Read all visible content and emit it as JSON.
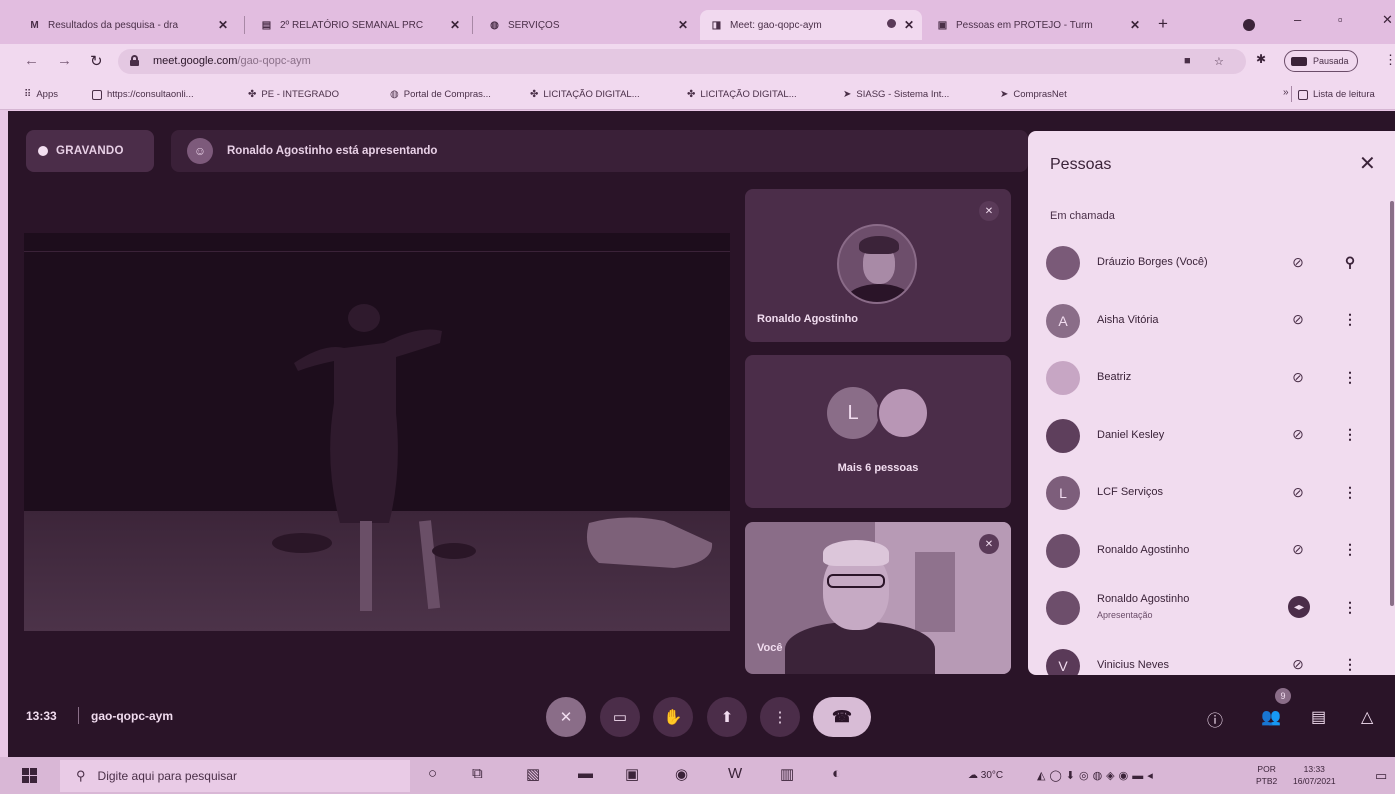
{
  "browser": {
    "tabs": [
      {
        "title": "Resultados da pesquisa - dra",
        "icon": "gmail-icon",
        "active": false
      },
      {
        "title": "2º RELATÓRIO SEMANAL PRC",
        "icon": "doc-icon",
        "active": false
      },
      {
        "title": "SERVIÇOS",
        "icon": "globe-icon",
        "active": false
      },
      {
        "title": "Meet: gao-qopc-aym",
        "icon": "meet-icon",
        "active": true
      },
      {
        "title": "Pessoas em PROTEJO - Turm",
        "icon": "classroom-icon",
        "active": false
      }
    ],
    "url_host": "meet.google.com",
    "url_path": "/gao-qopc-aym",
    "profile_status": "Pausada",
    "bookmarks": [
      {
        "label": "Apps",
        "icon": "apps-grid-icon"
      },
      {
        "label": "https://consultaonli...",
        "icon": "page-icon"
      },
      {
        "label": "PE - INTEGRADO",
        "icon": "emblem-icon"
      },
      {
        "label": "Portal de Compras...",
        "icon": "globe-icon"
      },
      {
        "label": "LICITAÇÃO DIGITAL...",
        "icon": "emblem-icon"
      },
      {
        "label": "LICITAÇÃO DIGITAL...",
        "icon": "emblem-icon"
      },
      {
        "label": "SIASG - Sistema Int...",
        "icon": "arrow-icon"
      },
      {
        "label": "ComprasNet",
        "icon": "arrow-icon"
      }
    ],
    "reading_list": "Lista de leitura"
  },
  "meet": {
    "recording_label": "GRAVANDO",
    "presenting_text": "Ronaldo Agostinho está apresentando",
    "tiles": {
      "ronaldo_name": "Ronaldo Agostinho",
      "more_initial": "L",
      "more_label": "Mais 6 pessoas",
      "you_label": "Você"
    },
    "time": "13:33",
    "meeting_code": "gao-qopc-aym",
    "people_badge": "9"
  },
  "people_panel": {
    "title": "Pessoas",
    "section": "Em chamada",
    "people": [
      {
        "name": "Dráuzio Borges (Você)",
        "initial": "",
        "avatar_color": "#7a5a78",
        "sub": "",
        "mic": "muted",
        "action": "pin"
      },
      {
        "name": "Aisha Vitória",
        "initial": "A",
        "avatar_color": "#8a6d88",
        "sub": "",
        "mic": "muted",
        "action": "menu"
      },
      {
        "name": "Beatriz",
        "initial": "",
        "avatar_color": "#c7a6c4",
        "sub": "",
        "mic": "muted",
        "action": "menu"
      },
      {
        "name": "Daniel Kesley",
        "initial": "",
        "avatar_color": "#5e3f5c",
        "sub": "",
        "mic": "muted",
        "action": "menu"
      },
      {
        "name": "LCF Serviços",
        "initial": "L",
        "avatar_color": "#7d5e7b",
        "sub": "",
        "mic": "muted",
        "action": "menu"
      },
      {
        "name": "Ronaldo Agostinho",
        "initial": "",
        "avatar_color": "#6d4e6b",
        "sub": "",
        "mic": "muted",
        "action": "menu"
      },
      {
        "name": "Ronaldo Agostinho",
        "initial": "",
        "avatar_color": "#6d4e6b",
        "sub": "Apresentação",
        "mic": "presenting",
        "action": "menu"
      },
      {
        "name": "Vinicius Neves",
        "initial": "V",
        "avatar_color": "#5a3a58",
        "sub": "",
        "mic": "muted",
        "action": "menu"
      }
    ]
  },
  "taskbar": {
    "search_placeholder": "Digite aqui para pesquisar",
    "temperature": "30°C",
    "lang_top": "POR",
    "lang_bottom": "PTB2",
    "clock_time": "13:33",
    "clock_date": "16/07/2021"
  },
  "colors": {
    "tint": "#e9c7e6",
    "meet_bg": "#2a1428",
    "panel_bg": "#f1dcef"
  }
}
